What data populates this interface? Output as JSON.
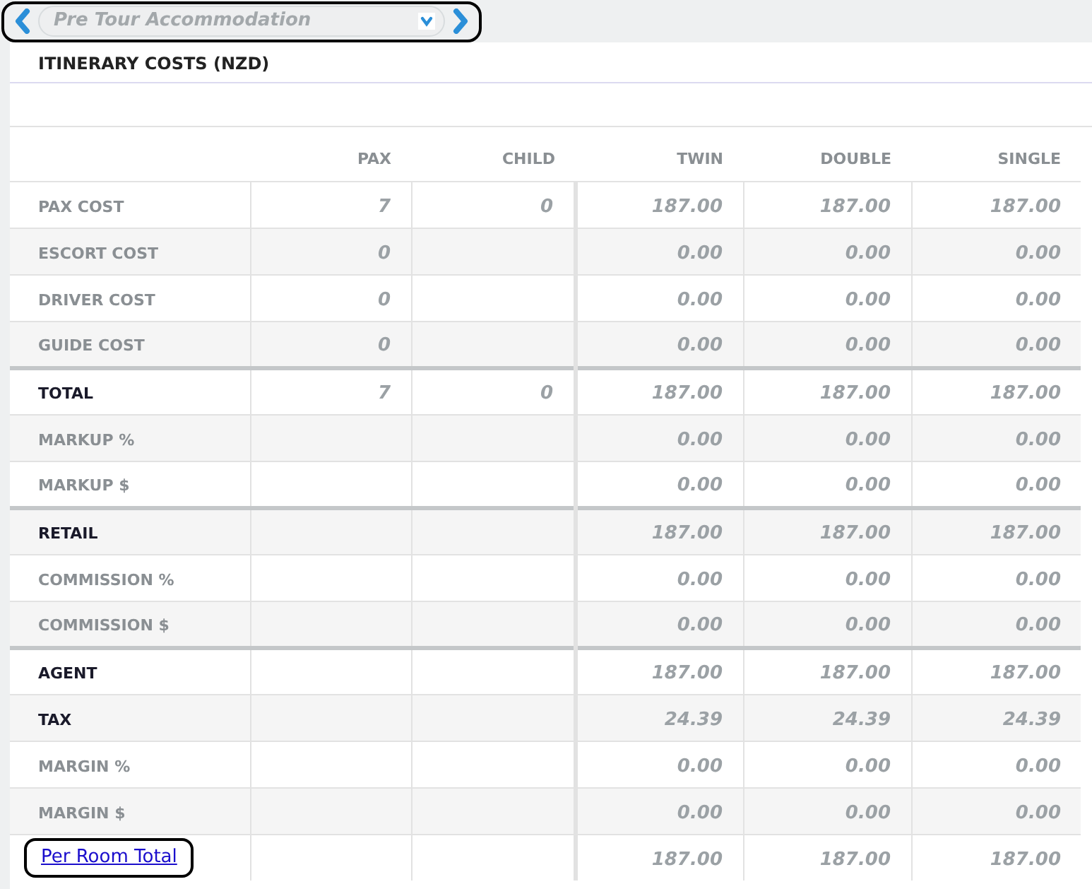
{
  "nav": {
    "selected_option": "Pre Tour Accommodation"
  },
  "title": "ITINERARY COSTS (NZD)",
  "columns": [
    "PAX",
    "CHILD",
    "TWIN",
    "DOUBLE",
    "SINGLE"
  ],
  "rows": [
    {
      "label": "PAX COST",
      "kind": "plain",
      "separator_above": false,
      "pax": "7",
      "child": "0",
      "twin": "187.00",
      "double": "187.00",
      "single": "187.00"
    },
    {
      "label": "ESCORT COST",
      "kind": "plain",
      "separator_above": false,
      "pax": "0",
      "twin": "0.00",
      "double": "0.00",
      "single": "0.00"
    },
    {
      "label": "DRIVER COST",
      "kind": "plain",
      "separator_above": false,
      "pax": "0",
      "twin": "0.00",
      "double": "0.00",
      "single": "0.00"
    },
    {
      "label": "GUIDE COST",
      "kind": "plain",
      "separator_above": false,
      "pax": "0",
      "twin": "0.00",
      "double": "0.00",
      "single": "0.00"
    },
    {
      "label": "TOTAL",
      "kind": "strong",
      "separator_above": true,
      "pax": "7",
      "child": "0",
      "twin": "187.00",
      "double": "187.00",
      "single": "187.00"
    },
    {
      "label": "MARKUP %",
      "kind": "plain",
      "separator_above": false,
      "twin": "0.00",
      "double": "0.00",
      "single": "0.00"
    },
    {
      "label": "MARKUP $",
      "kind": "plain",
      "separator_above": false,
      "twin": "0.00",
      "double": "0.00",
      "single": "0.00"
    },
    {
      "label": "RETAIL",
      "kind": "strong",
      "separator_above": true,
      "twin": "187.00",
      "double": "187.00",
      "single": "187.00"
    },
    {
      "label": "COMMISSION %",
      "kind": "plain",
      "separator_above": false,
      "twin": "0.00",
      "double": "0.00",
      "single": "0.00"
    },
    {
      "label": "COMMISSION $",
      "kind": "plain",
      "separator_above": false,
      "twin": "0.00",
      "double": "0.00",
      "single": "0.00"
    },
    {
      "label": "AGENT",
      "kind": "strong",
      "separator_above": true,
      "twin": "187.00",
      "double": "187.00",
      "single": "187.00"
    },
    {
      "label": "TAX",
      "kind": "strong",
      "separator_above": false,
      "twin": "24.39",
      "double": "24.39",
      "single": "24.39"
    },
    {
      "label": "MARGIN %",
      "kind": "plain",
      "separator_above": false,
      "twin": "0.00",
      "double": "0.00",
      "single": "0.00"
    },
    {
      "label": "MARGIN $",
      "kind": "plain",
      "separator_above": false,
      "twin": "0.00",
      "double": "0.00",
      "single": "0.00"
    },
    {
      "label": "Per Room Total",
      "kind": "link",
      "separator_above": false,
      "twin": "187.00",
      "double": "187.00",
      "single": "187.00"
    }
  ]
}
